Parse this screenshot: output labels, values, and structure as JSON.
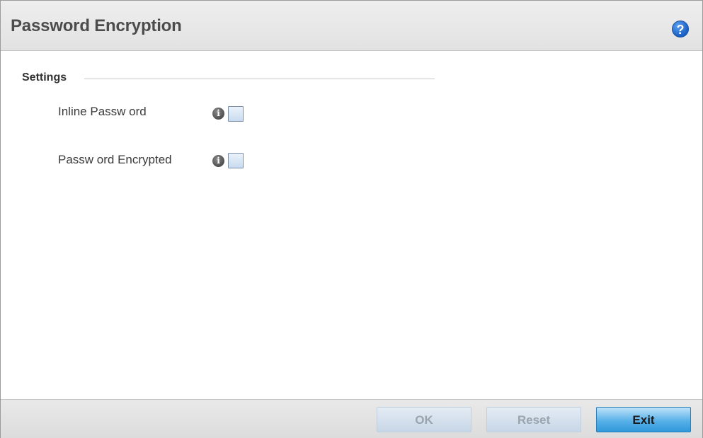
{
  "dialog": {
    "title": "Password Encryption",
    "help_icon": "help-question-icon",
    "help_glyph": "?"
  },
  "settings": {
    "section_label": "Settings",
    "fields": [
      {
        "label": "Inline Passw ord",
        "info_icon": "info-icon",
        "info_glyph": "i",
        "checked": false
      },
      {
        "label": "Passw ord Encrypted",
        "info_icon": "info-icon",
        "info_glyph": "i",
        "checked": false
      }
    ]
  },
  "footer": {
    "ok_label": "OK",
    "reset_label": "Reset",
    "exit_label": "Exit"
  },
  "colors": {
    "header_bg": "#e6e6e6",
    "title_text": "#4c4c4c",
    "help_blue": "#1a5fc4",
    "primary_button": "#3fa2e0",
    "disabled_button": "#d3e0ec"
  }
}
